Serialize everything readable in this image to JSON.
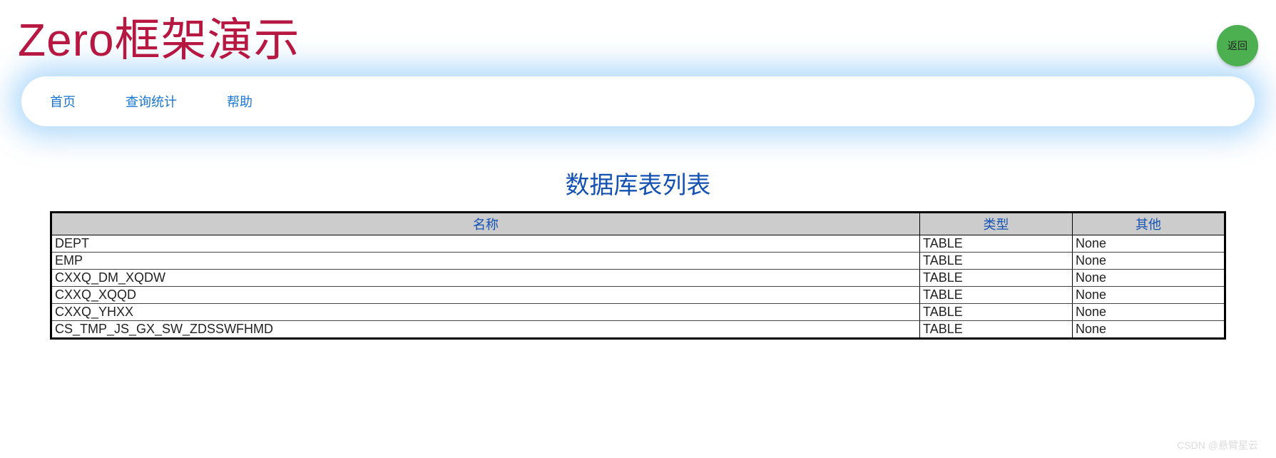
{
  "header": {
    "title": "Zero框架演示",
    "back_label": "返回"
  },
  "nav": {
    "items": [
      {
        "label": "首页"
      },
      {
        "label": "查询统计"
      },
      {
        "label": "帮助"
      }
    ]
  },
  "content": {
    "title": "数据库表列表",
    "table": {
      "columns": [
        {
          "label": "名称"
        },
        {
          "label": "类型"
        },
        {
          "label": "其他"
        }
      ],
      "rows": [
        {
          "name": "DEPT",
          "type": "TABLE",
          "other": "None"
        },
        {
          "name": "EMP",
          "type": "TABLE",
          "other": "None"
        },
        {
          "name": "CXXQ_DM_XQDW",
          "type": "TABLE",
          "other": "None"
        },
        {
          "name": "CXXQ_XQQD",
          "type": "TABLE",
          "other": "None"
        },
        {
          "name": "CXXQ_YHXX",
          "type": "TABLE",
          "other": "None"
        },
        {
          "name": "CS_TMP_JS_GX_SW_ZDSSWFHMD",
          "type": "TABLE",
          "other": "None"
        }
      ]
    }
  },
  "watermark": "CSDN @悬臂星云"
}
